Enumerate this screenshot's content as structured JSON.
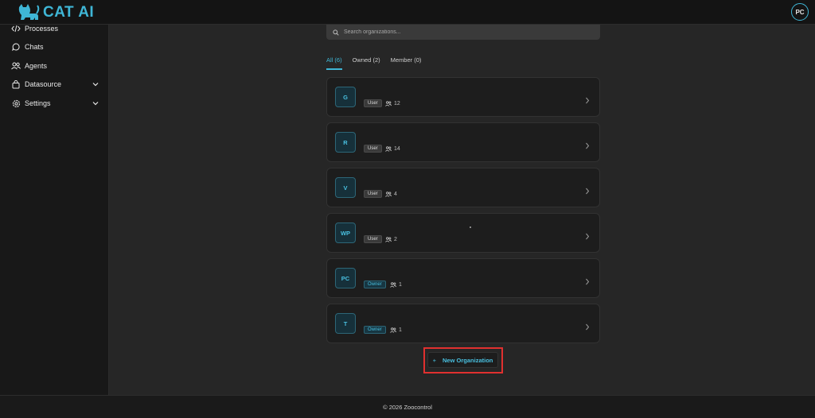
{
  "app": {
    "brand": "CAT AI",
    "user_initials": "PC"
  },
  "sidebar": {
    "items": [
      {
        "label": "Processes",
        "icon": "code-icon",
        "expandable": false
      },
      {
        "label": "Chats",
        "icon": "chat-bubble-icon",
        "expandable": false
      },
      {
        "label": "Agents",
        "icon": "users-icon",
        "expandable": false
      },
      {
        "label": "Datasource",
        "icon": "shopping-bag-icon",
        "expandable": true
      },
      {
        "label": "Settings",
        "icon": "gear-icon",
        "expandable": true
      }
    ]
  },
  "search": {
    "placeholder": "Search organizations..."
  },
  "tabs": [
    {
      "label": "All (6)",
      "active": true
    },
    {
      "label": "Owned (2)",
      "active": false
    },
    {
      "label": "Member (0)",
      "active": false
    }
  ],
  "organizations": [
    {
      "initials": "G",
      "role": "User",
      "members": "12"
    },
    {
      "initials": "R",
      "role": "User",
      "members": "14"
    },
    {
      "initials": "V",
      "role": "User",
      "members": "4"
    },
    {
      "initials": "WP",
      "role": "User",
      "members": "2"
    },
    {
      "initials": "PC",
      "role": "Owner",
      "members": "1"
    },
    {
      "initials": "T",
      "role": "Owner",
      "members": "1"
    }
  ],
  "new_org_button": {
    "icon": "plus-icon",
    "label": "New Organization"
  },
  "footer": {
    "text": "© 2026 Zoocontrol"
  },
  "colors": {
    "accent": "#3fb6d6",
    "highlight": "#e0302f",
    "background": "#262626",
    "card": "#1d1d1d"
  }
}
